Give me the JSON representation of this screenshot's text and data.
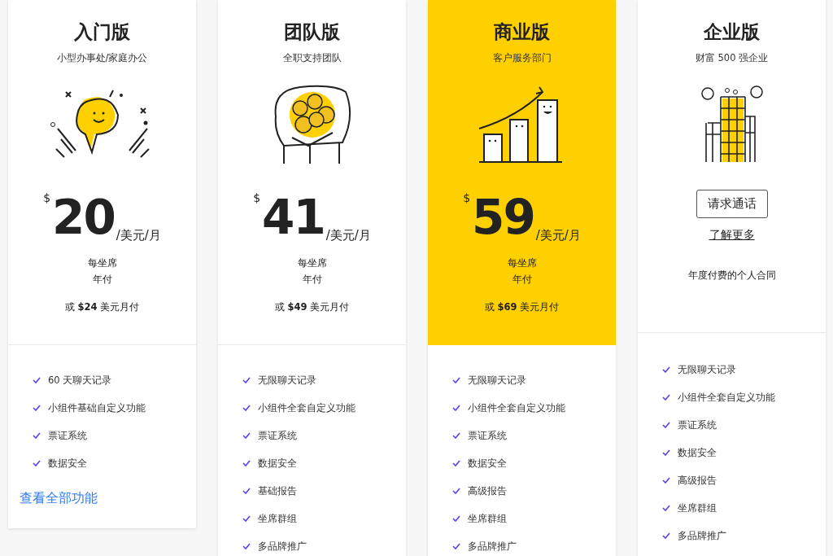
{
  "plans": [
    {
      "kind": "price",
      "name": "入门版",
      "subtitle": "小型办事处/家庭办公",
      "highlighted": false,
      "currency": "$",
      "amount": "20",
      "unit": "/美元/月",
      "seat": "每坐席",
      "billing": "年付",
      "monthly": "或 **$24** 美元月付",
      "features": [
        "60 天聊天记录",
        "小组件基础自定义功能",
        "票证系统",
        "数据安全"
      ],
      "more_link": "查看全部功能"
    },
    {
      "kind": "price",
      "name": "团队版",
      "subtitle": "全职支持团队",
      "highlighted": false,
      "currency": "$",
      "amount": "41",
      "unit": "/美元/月",
      "seat": "每坐席",
      "billing": "年付",
      "monthly": "或 **$49** 美元月付",
      "features": [
        "无限聊天记录",
        "小组件全套自定义功能",
        "票证系统",
        "数据安全",
        "基础报告",
        "坐席群组",
        "多品牌推广"
      ]
    },
    {
      "kind": "price",
      "name": "商业版",
      "subtitle": "客户服务部门",
      "highlighted": true,
      "currency": "$",
      "amount": "59",
      "unit": "/美元/月",
      "seat": "每坐席",
      "billing": "年付",
      "monthly": "或 **$69** 美元月付",
      "features": [
        "无限聊天记录",
        "小组件全套自定义功能",
        "票证系统",
        "数据安全",
        "高级报告",
        "坐席群组",
        "多品牌推广"
      ]
    },
    {
      "kind": "contact",
      "name": "企业版",
      "subtitle": "财富 500 强企业",
      "highlighted": false,
      "button": "请求通话",
      "link": "了解更多",
      "note": "年度付费的个人合同",
      "features": [
        "无限聊天记录",
        "小组件全套自定义功能",
        "票证系统",
        "数据安全",
        "高级报告",
        "坐席群组",
        "多品牌推广"
      ]
    }
  ]
}
